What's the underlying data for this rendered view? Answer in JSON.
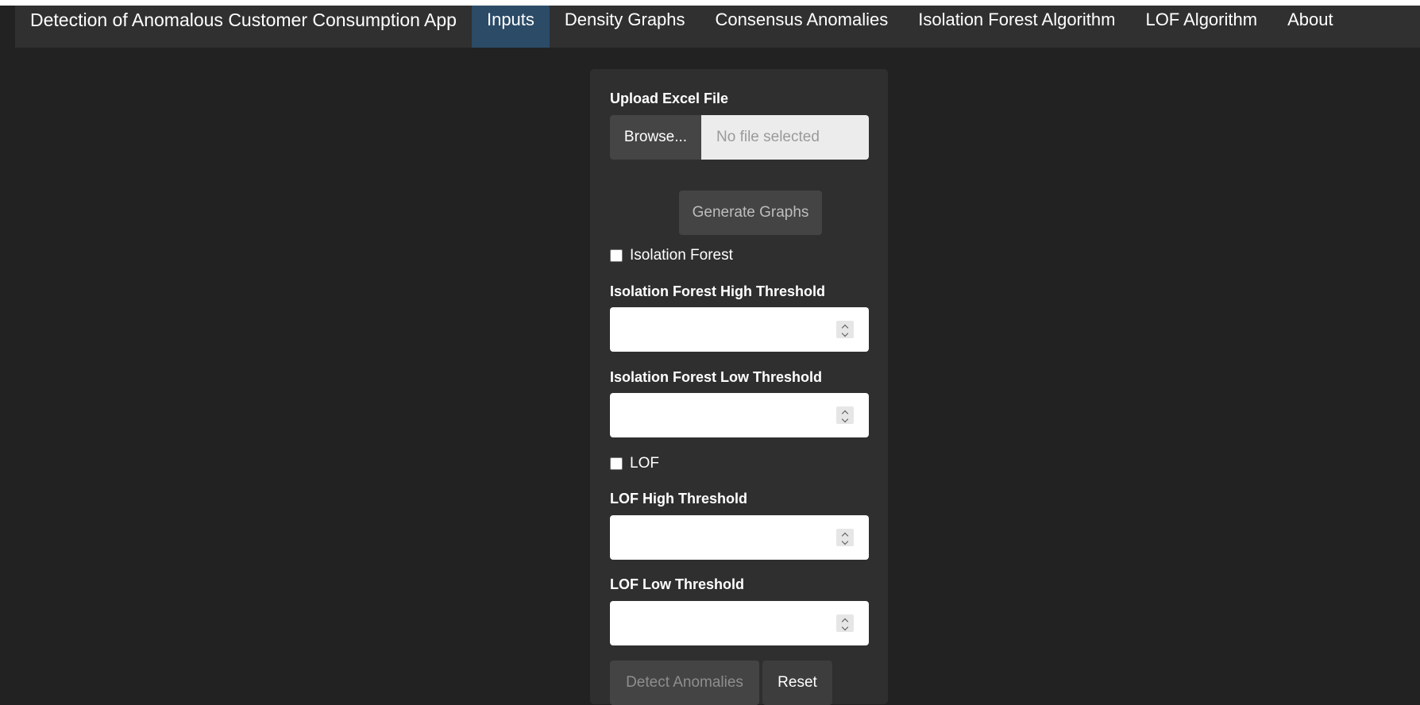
{
  "navbar": {
    "brand": "Detection of Anomalous Customer Consumption App",
    "links": [
      {
        "label": "Inputs",
        "active": true
      },
      {
        "label": "Density Graphs",
        "active": false
      },
      {
        "label": "Consensus Anomalies",
        "active": false
      },
      {
        "label": "Isolation Forest Algorithm",
        "active": false
      },
      {
        "label": "LOF Algorithm",
        "active": false
      },
      {
        "label": "About",
        "active": false
      }
    ]
  },
  "form": {
    "upload": {
      "label": "Upload Excel File",
      "browse_label": "Browse...",
      "file_placeholder": "No file selected"
    },
    "generate_label": "Generate Graphs",
    "isolation_forest": {
      "checkbox_label": "Isolation Forest",
      "checked": false,
      "high_label": "Isolation Forest High Threshold",
      "high_value": "",
      "low_label": "Isolation Forest Low Threshold",
      "low_value": ""
    },
    "lof": {
      "checkbox_label": "LOF",
      "checked": false,
      "high_label": "LOF High Threshold",
      "high_value": "",
      "low_label": "LOF Low Threshold",
      "low_value": ""
    },
    "detect_label": "Detect Anomalies",
    "reset_label": "Reset"
  },
  "colors": {
    "background": "#222222",
    "navbar": "#303030",
    "nav_active": "#2b4b67",
    "panel": "#2f2f2f",
    "button": "#444444"
  }
}
